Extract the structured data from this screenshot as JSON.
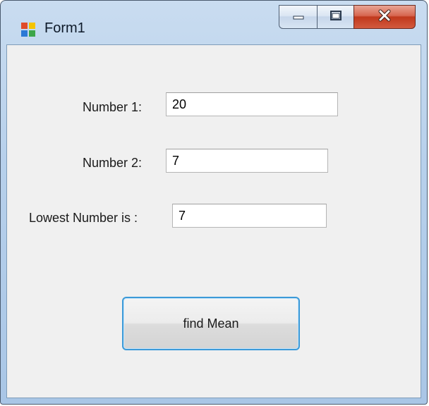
{
  "window": {
    "title": "Form1",
    "controls": {
      "minimize": "minimize",
      "maximize": "maximize",
      "close": "close"
    }
  },
  "form": {
    "number1": {
      "label": "Number 1:",
      "value": "20"
    },
    "number2": {
      "label": "Number 2:",
      "value": "7"
    },
    "lowest": {
      "label": "Lowest Number is :",
      "value": "7"
    },
    "button_label": "find Mean"
  },
  "colors": {
    "client_bg": "#f0f0f0",
    "button_border": "#3c9ad8",
    "close_red": "#c0391d"
  }
}
